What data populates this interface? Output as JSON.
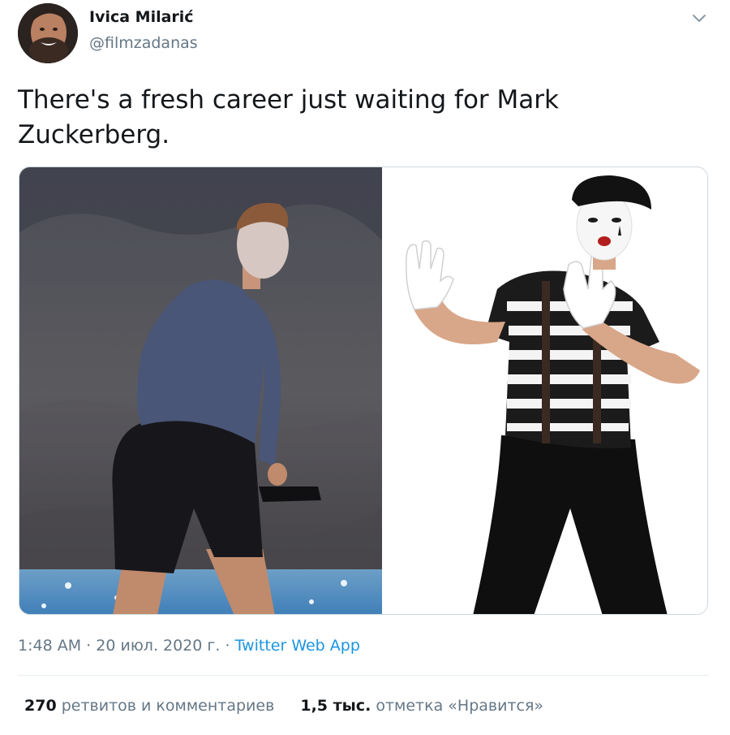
{
  "author": {
    "name": "Ivica Milarić",
    "handle": "@filmzadanas"
  },
  "tweet": {
    "text_line1": "There's a fresh career just waiting for Mark",
    "text_line2": "Zuckerberg."
  },
  "meta": {
    "time": "1:48 AM",
    "separator": "·",
    "date": "20 июл. 2020 г.",
    "source": "Twitter Web App"
  },
  "stats": {
    "retweets_count": "270",
    "retweets_label": "ретвитов и комментариев",
    "likes_count": "1,5 тыс.",
    "likes_label": "отметка «Нравится»"
  },
  "icons": {
    "more": "chevron-down-icon"
  },
  "colors": {
    "text": "#14171a",
    "secondary": "#657786",
    "link": "#1b95e0",
    "border": "#ccd6dd"
  }
}
